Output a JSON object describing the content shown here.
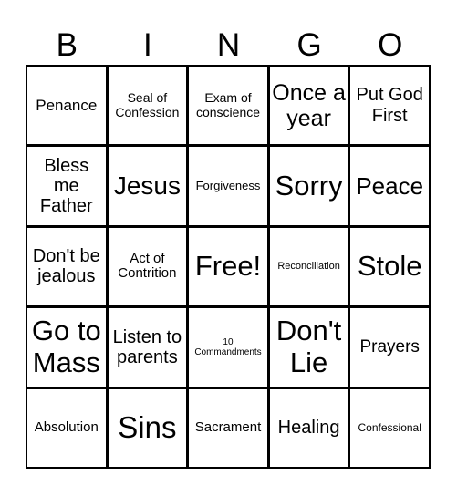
{
  "header": {
    "letters": [
      "B",
      "I",
      "N",
      "G",
      "O"
    ]
  },
  "board": {
    "rows": [
      [
        "Penance",
        "Seal of Confession",
        "Exam of conscience",
        "Once a year",
        "Put God First"
      ],
      [
        "Bless me Father",
        "Jesus",
        "Forgiveness",
        "Sorry",
        "Peace"
      ],
      [
        "Don't be jealous",
        "Act of Contrition",
        "Free!",
        "Reconciliation",
        "Stole"
      ],
      [
        "Go to Mass",
        "Listen to parents",
        "10 Commandments",
        "Don't Lie",
        "Prayers"
      ],
      [
        "Absolution",
        "Sins",
        "Sacrament",
        "Healing",
        "Confessional"
      ]
    ],
    "free_space": "Free!"
  },
  "colors": {
    "background": "#ffffff",
    "text": "#000000",
    "grid_lines": "#000000"
  }
}
